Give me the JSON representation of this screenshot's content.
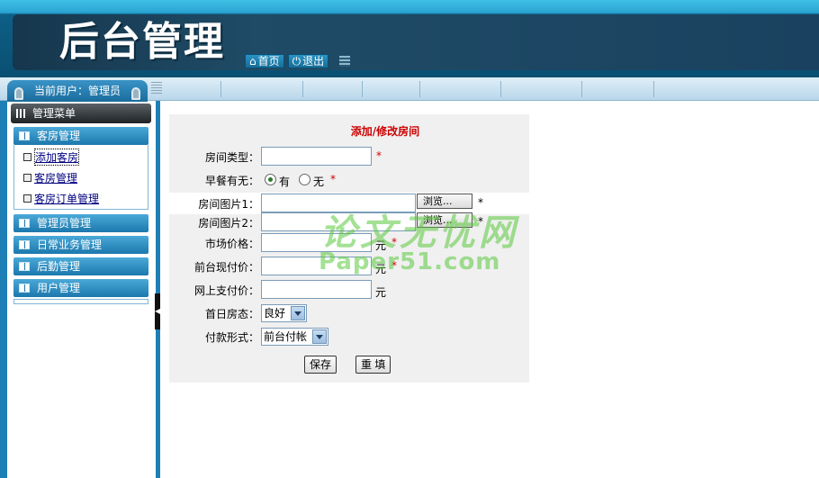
{
  "header": {
    "logo_text": "后台管理",
    "nav": [
      {
        "icon": "home-icon",
        "glyph": "⌂",
        "label": "首页"
      },
      {
        "icon": "power-icon",
        "glyph": "⏻",
        "label": "退出"
      }
    ]
  },
  "sidebar": {
    "current_user": "当前用户：管理员",
    "menu_title": "管理菜单",
    "sections": [
      {
        "label": "客房管理",
        "items": [
          {
            "label": "添加客房"
          },
          {
            "label": "客房管理"
          },
          {
            "label": "客房订单管理"
          }
        ]
      },
      {
        "label": "管理员管理"
      },
      {
        "label": "日常业务管理"
      },
      {
        "label": "后勤管理"
      },
      {
        "label": "用户管理"
      }
    ]
  },
  "form": {
    "title": "添加/修改房间",
    "required_mark": "*",
    "fields": {
      "room_type": {
        "label": "房间类型：",
        "value": ""
      },
      "breakfast": {
        "label": "早餐有无：",
        "options": [
          "有",
          "无"
        ],
        "selected": "有"
      },
      "image1": {
        "label": "房间图片1：",
        "value": "",
        "browse": "浏览..."
      },
      "image2": {
        "label": "房间图片2：",
        "value": "",
        "browse": "浏览..."
      },
      "market_price": {
        "label": "市场价格：",
        "value": "",
        "unit": "元"
      },
      "front_price": {
        "label": "前台现付价：",
        "value": "",
        "unit": "元"
      },
      "online_price": {
        "label": "网上支付价：",
        "value": "",
        "unit": "元"
      },
      "first_day_status": {
        "label": "首日房态：",
        "selected": "良好"
      },
      "payment_method": {
        "label": "付款形式：",
        "selected": "前台付帐"
      }
    },
    "save_label": "保存",
    "reset_label": "重 填"
  },
  "watermark": {
    "line1": "论文无忧网",
    "line2": "Paper51.com"
  }
}
